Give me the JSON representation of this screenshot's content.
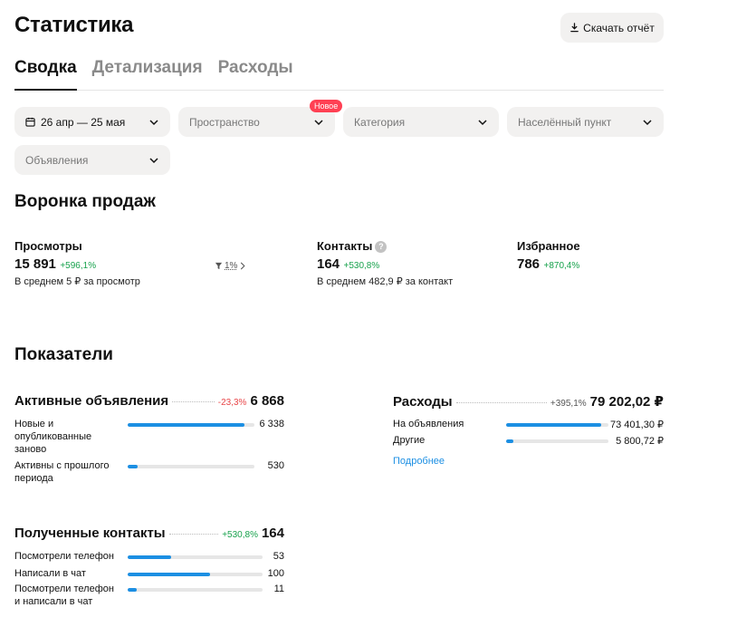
{
  "header": {
    "title": "Статистика",
    "download_label": "Скачать отчёт"
  },
  "tabs": [
    {
      "label": "Сводка",
      "active": true
    },
    {
      "label": "Детализация",
      "active": false
    },
    {
      "label": "Расходы",
      "active": false
    }
  ],
  "filters": {
    "period": "26 апр — 25 мая",
    "space": "Пространство",
    "space_badge": "Новое",
    "category": "Категория",
    "city": "Населённый пункт",
    "ads": "Объявления"
  },
  "funnel": {
    "title": "Воронка продаж",
    "views": {
      "label": "Просмотры",
      "value": "15 891",
      "delta": "+596,1%",
      "sub": "В среднем 5 ₽ за просмотр"
    },
    "conversion": "1%",
    "contacts": {
      "label": "Контакты",
      "value": "164",
      "delta": "+530,8%",
      "sub": "В среднем 482,9 ₽ за контакт"
    },
    "favorites": {
      "label": "Избранное",
      "value": "786",
      "delta": "+870,4%"
    }
  },
  "metrics": {
    "title": "Показатели",
    "active_ads": {
      "name": "Активные объявления",
      "delta": "-23,3%",
      "total": "6 868",
      "rows": [
        {
          "label": "Новые и опубликованные заново",
          "value": "6 338",
          "fill": 0.92
        },
        {
          "label": "Активны с прошлого периода",
          "value": "530",
          "fill": 0.08
        }
      ]
    },
    "expenses": {
      "name": "Расходы",
      "delta": "+395,1%",
      "total": "79 202,02 ₽",
      "rows": [
        {
          "label": "На объявления",
          "value": "73 401,30 ₽",
          "fill": 0.93
        },
        {
          "label": "Другие",
          "value": "5 800,72 ₽",
          "fill": 0.07
        }
      ],
      "more_link": "Подробнее"
    },
    "contacts": {
      "name": "Полученные контакты",
      "delta": "+530,8%",
      "total": "164",
      "rows": [
        {
          "label": "Посмотрели телефон",
          "value": "53",
          "fill": 0.32
        },
        {
          "label": "Написали в чат",
          "value": "100",
          "fill": 0.61
        },
        {
          "label": "Посмотрели телефон и написали в чат",
          "value": "11",
          "fill": 0.07
        }
      ]
    }
  },
  "colors": {
    "accent_blue": "#1c8fe3",
    "positive_green": "#18a24d",
    "negative_red": "#e8474a",
    "badge_red": "#ff4053",
    "chip_bg": "#f2f1f0"
  }
}
